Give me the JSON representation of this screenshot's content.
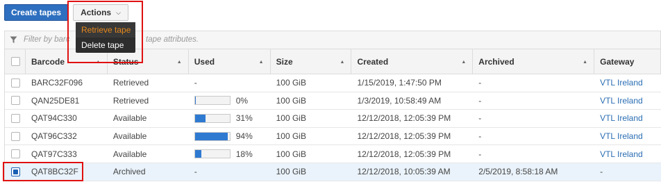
{
  "toolbar": {
    "create_label": "Create tapes",
    "actions_label": "Actions",
    "actions_icon": "chevron-down-icon",
    "menu": [
      "Retrieve tape",
      "Delete tape"
    ]
  },
  "filter": {
    "placeholder": "Filter by barcode, status or other tape attributes.",
    "visible_start": "Filter by barc",
    "visible_end": "tape attributes."
  },
  "table": {
    "columns": [
      "Barcode",
      "Status",
      "Used",
      "Size",
      "Created",
      "Archived",
      "Gateway"
    ],
    "rows": [
      {
        "barcode": "BARC32F096",
        "status": "Retrieved",
        "used": "-",
        "used_fraction": null,
        "size": "100 GiB",
        "created": "1/15/2019, 1:47:50 PM",
        "archived": "-",
        "gateway": "VTL Ireland",
        "selected": false
      },
      {
        "barcode": "QAN25DE81",
        "status": "Retrieved",
        "used": "0%",
        "used_fraction": 0.0,
        "size": "100 GiB",
        "created": "1/3/2019, 10:58:49 AM",
        "archived": "-",
        "gateway": "VTL Ireland",
        "selected": false
      },
      {
        "barcode": "QAT94C330",
        "status": "Available",
        "used": "31%",
        "used_fraction": 0.31,
        "size": "100 GiB",
        "created": "12/12/2018, 12:05:39 PM",
        "archived": "-",
        "gateway": "VTL Ireland",
        "selected": false
      },
      {
        "barcode": "QAT96C332",
        "status": "Available",
        "used": "94%",
        "used_fraction": 0.94,
        "size": "100 GiB",
        "created": "12/12/2018, 12:05:39 PM",
        "archived": "-",
        "gateway": "VTL Ireland",
        "selected": false
      },
      {
        "barcode": "QAT97C333",
        "status": "Available",
        "used": "18%",
        "used_fraction": 0.18,
        "size": "100 GiB",
        "created": "12/12/2018, 12:05:39 PM",
        "archived": "-",
        "gateway": "VTL Ireland",
        "selected": false
      },
      {
        "barcode": "QAT8BC32F",
        "status": "Archived",
        "used": "-",
        "used_fraction": null,
        "size": "100 GiB",
        "created": "12/12/2018, 10:05:39 AM",
        "archived": "2/5/2019, 8:58:18 AM",
        "gateway": "-",
        "selected": true
      }
    ]
  },
  "colors": {
    "primary": "#2f6fbf",
    "link": "#2a6db3",
    "highlight": "#e01010",
    "menu_active": "#e8891c",
    "bar": "#2f7ad1"
  }
}
